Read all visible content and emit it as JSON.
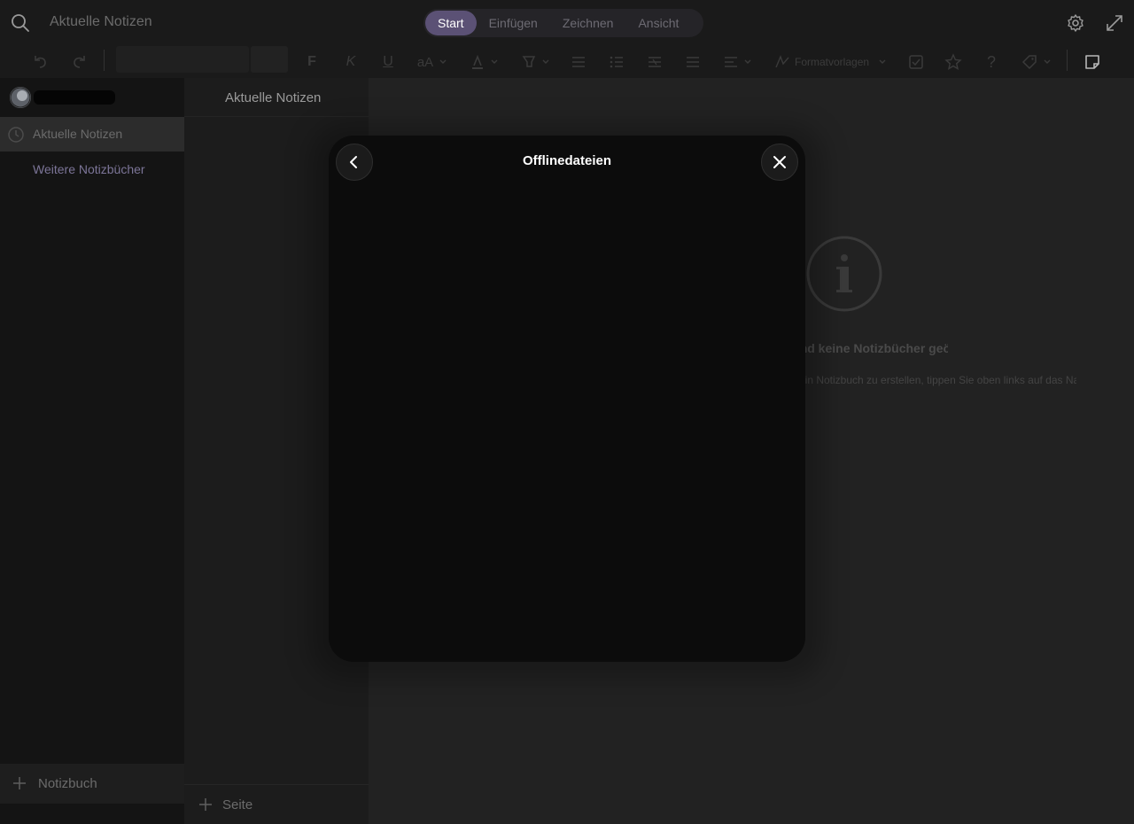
{
  "titlebar": {
    "title": "Aktuelle Notizen",
    "tabs": [
      {
        "label": "Start",
        "active": true
      },
      {
        "label": "Einfügen",
        "active": false
      },
      {
        "label": "Zeichnen",
        "active": false
      },
      {
        "label": "Ansicht",
        "active": false
      }
    ],
    "icons": [
      "search-icon",
      "gear-icon",
      "expand-icon"
    ]
  },
  "ribbon": {
    "bold_label": "F",
    "italic_label": "K",
    "underline_label": "U",
    "text_size_label": "aA",
    "styles_label": "Formatvorlagen",
    "icons": [
      "undo-icon",
      "redo-icon",
      "highlighter-icon",
      "font-color-icon",
      "bullet-list-icon",
      "numbered-list-icon",
      "outdent-icon",
      "indent-icon",
      "align-icon",
      "checkbox-icon",
      "star-icon",
      "question-icon",
      "tag-icon",
      "sticky-note-icon"
    ]
  },
  "sidebar": {
    "items": [
      {
        "label": "Aktuelle Notizen",
        "selected": true
      },
      {
        "label": "Weitere Notizbücher",
        "selected": false
      }
    ],
    "add_notebook_label": "Notizbuch"
  },
  "pages": {
    "title": "Aktuelle Notizen",
    "add_page_label": "Seite"
  },
  "canvas": {
    "empty_title": "Es sind keine Notizbücher geöffnet.",
    "empty_hint": "Um ein Notizbuch zu erstellen, tippen Sie oben links auf das Navigationsmenü."
  },
  "modal": {
    "title": "Offlinedateien"
  },
  "colors": {
    "accent": "#5b5175",
    "link": "#7c7598",
    "modal_bg": "#0c0c0c"
  }
}
